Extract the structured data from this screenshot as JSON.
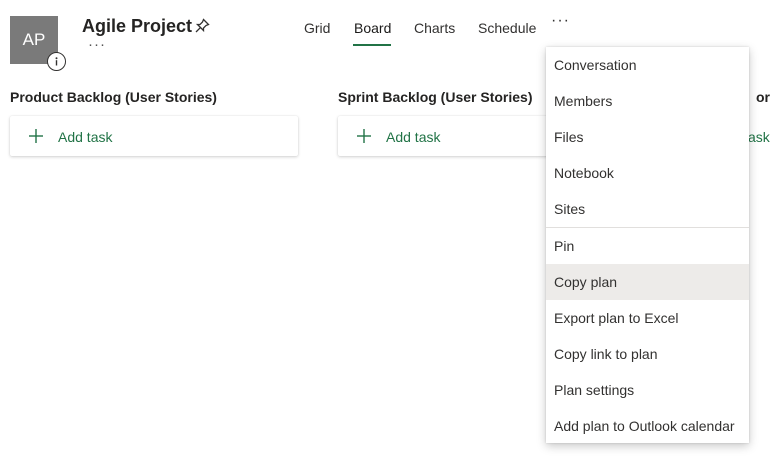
{
  "plan": {
    "avatar_initials": "AP",
    "title": "Agile Project"
  },
  "nav": {
    "tabs": [
      {
        "label": "Grid"
      },
      {
        "label": "Board"
      },
      {
        "label": "Charts"
      },
      {
        "label": "Schedule"
      }
    ],
    "active": "Board",
    "more": "···"
  },
  "columns": [
    {
      "title": "Product Backlog (User Stories)",
      "add_label": "Add task"
    },
    {
      "title": "Sprint Backlog (User Stories)",
      "add_label": "Add task"
    },
    {
      "title": "or Sp",
      "add_label": "ask"
    }
  ],
  "menu": {
    "items": [
      {
        "label": "Conversation"
      },
      {
        "label": "Members"
      },
      {
        "label": "Files"
      },
      {
        "label": "Notebook"
      },
      {
        "label": "Sites"
      },
      {
        "label": "Pin"
      },
      {
        "label": "Copy plan"
      },
      {
        "label": "Export plan to Excel"
      },
      {
        "label": "Copy link to plan"
      },
      {
        "label": "Plan settings"
      },
      {
        "label": "Add plan to Outlook calendar"
      }
    ],
    "hovered": "Copy plan"
  },
  "colors": {
    "accent_green": "#217346",
    "avatar_bg": "#7a7a7a",
    "hover_bg": "#edebe9"
  },
  "icons": [
    "info-icon",
    "pin-icon",
    "more-icon",
    "plus-icon"
  ]
}
